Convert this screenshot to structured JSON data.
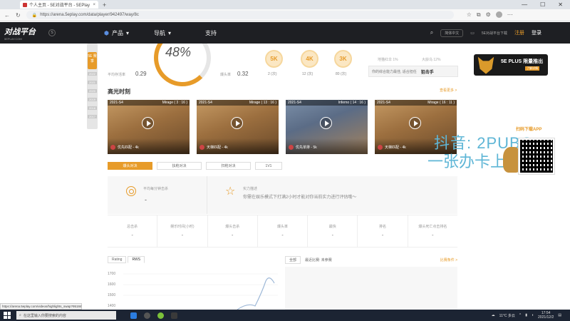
{
  "browser": {
    "tab_title": "个人主页 - 5E对战平台 - 5EPlay",
    "url": "https://arena.5eplay.com/data/player/942497/way/8c"
  },
  "site": {
    "logo_text": "对战平台",
    "logo_sub": "5EPLAY.COM",
    "region_badge": "S",
    "nav": {
      "products": "产品",
      "guide": "导航",
      "support": "支持"
    },
    "lang": "简体中文",
    "download": "5E对战平台下载",
    "register": "注册",
    "login": "登录"
  },
  "profile": {
    "timeline_badge": "5E 赛季",
    "timeline_years": [
      "2022",
      "2021",
      "2020",
      "2019",
      "2018",
      "2017"
    ],
    "stats": [
      {
        "label": "平均存活率",
        "value": "0.29"
      },
      {
        "label": "爆头率",
        "value": "0.32"
      }
    ],
    "win_rate": "48%",
    "medals": [
      {
        "label": "5K",
        "count": "2 (次)"
      },
      {
        "label": "4K",
        "count": "12 (次)"
      },
      {
        "label": "3K",
        "count": "80 (次)"
      }
    ],
    "rank_notes": [
      "地猫红伞 1%",
      "大龄乌 12%"
    ],
    "rank_box_text": "你的综合能力最佳, 适合担任",
    "rank_box_role": "狙击手"
  },
  "highlights": {
    "title": "高光时刻",
    "more": "查看更多 >",
    "cards": [
      {
        "season": "2021-S4",
        "map": "Mirage ( 3 : 16 )",
        "mode": "优先匹配 - 4k",
        "color": "#b4854f"
      },
      {
        "season": "2021-S4",
        "map": "Mirage ( 13 : 16 )",
        "mode": "天梯匹配 - 4k",
        "color": "#b4854f"
      },
      {
        "season": "2021-S4",
        "map": "Inferno ( 14 : 16 )",
        "mode": "优先单排 - 5k",
        "color": "#6f7f98"
      },
      {
        "season": "2021-S4",
        "map": "Mirage ( 16 : 11 )",
        "mode": "天梯匹配 - 4k",
        "color": "#b4854f"
      }
    ]
  },
  "filters": [
    "爆头对决",
    "扶枪对决",
    "扫枪对决",
    "1V1"
  ],
  "practice": {
    "avg_label": "平均每分钟击杀",
    "avg_value": "-",
    "strength_label": "实力描述",
    "strength_msg": "你需在娱乐模式下打满2小时才能对你当前实力进行评估哦～"
  },
  "metrics": [
    {
      "label": "总击杀",
      "value": "-"
    },
    {
      "label": "娱乐时间(小时)",
      "value": "-"
    },
    {
      "label": "爆头击杀",
      "value": "-"
    },
    {
      "label": "爆头率",
      "value": "-"
    },
    {
      "label": "最快",
      "value": "-"
    },
    {
      "label": "排名",
      "value": "-"
    },
    {
      "label": "爆头死亡点击排名",
      "value": "-"
    }
  ],
  "chart": {
    "tabs": [
      "Rating",
      "RWS"
    ],
    "yticks": [
      "1700",
      "1600",
      "1500",
      "1400"
    ]
  },
  "matches": {
    "tab": "全部",
    "info": "最近比赛: 未参赛",
    "more": "比赛条件 >"
  },
  "overlay": {
    "promo_title": "5E PLUS 限量推出",
    "promo_btn": "了解详情",
    "douyin": "抖音: 2PUBG",
    "zhangban": "一张办卡上一把",
    "app_title": "扫码下载APP"
  },
  "statusbar_url": "https://arena.5eplay.com/videos/highlights_swap?951845",
  "taskbar": {
    "search": "在这里输入你要搜索的内容",
    "weather": "11°C 多云",
    "time": "17:54",
    "date": "2021/12/2"
  }
}
